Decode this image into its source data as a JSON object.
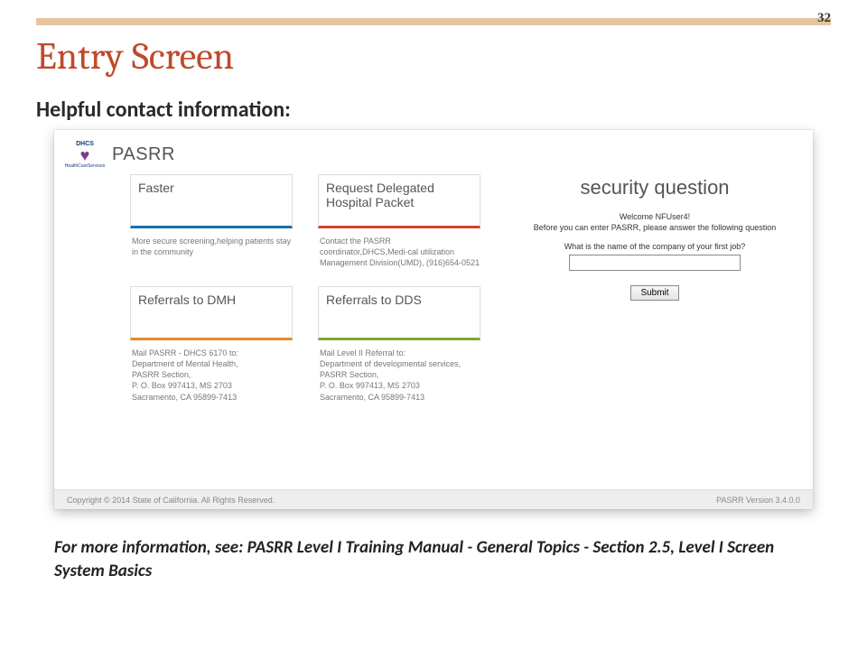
{
  "page_number": "32",
  "slide_title": "Entry Screen",
  "subtitle": "Helpful contact information:",
  "app": {
    "logo_top": "DHCS",
    "logo_bottom": "HealthCareServices",
    "title": "PASRR"
  },
  "cards": {
    "c1": {
      "label": "Faster",
      "desc": "More secure screening,helping patients stay in the community"
    },
    "c2": {
      "label": "Request Delegated Hospital Packet",
      "desc": "Contact the PASRR coordinator,DHCS,Medi-cal utilization Management Division(UMD), (916)654-0521"
    },
    "c3": {
      "label": "Referrals to DMH",
      "desc": "Mail PASRR - DHCS 6170 to:\nDepartment of Mental Health,\nPASRR Section,\nP. O. Box 997413, MS 2703\nSacramento, CA 95899-7413"
    },
    "c4": {
      "label": "Referrals to DDS",
      "desc": "Mail Level II Referral to:\nDepartment of developmental services, PASRR Section,\nP. O. Box 997413, MS 2703\nSacramento, CA 95899-7413"
    }
  },
  "security": {
    "heading": "security question",
    "welcome": "Welcome NFUser4!",
    "instruction": "Before you can enter PASRR, please answer the following question",
    "question": "What is the name of the company of your first job?",
    "submit": "Submit"
  },
  "footer": {
    "copyright": "Copyright © 2014 State of California. All Rights Reserved.",
    "version": "PASRR Version 3.4.0.0"
  },
  "note": "For more information, see:  PASRR  Level I Training Manual - General Topics - Section 2.5, Level I Screen System Basics"
}
